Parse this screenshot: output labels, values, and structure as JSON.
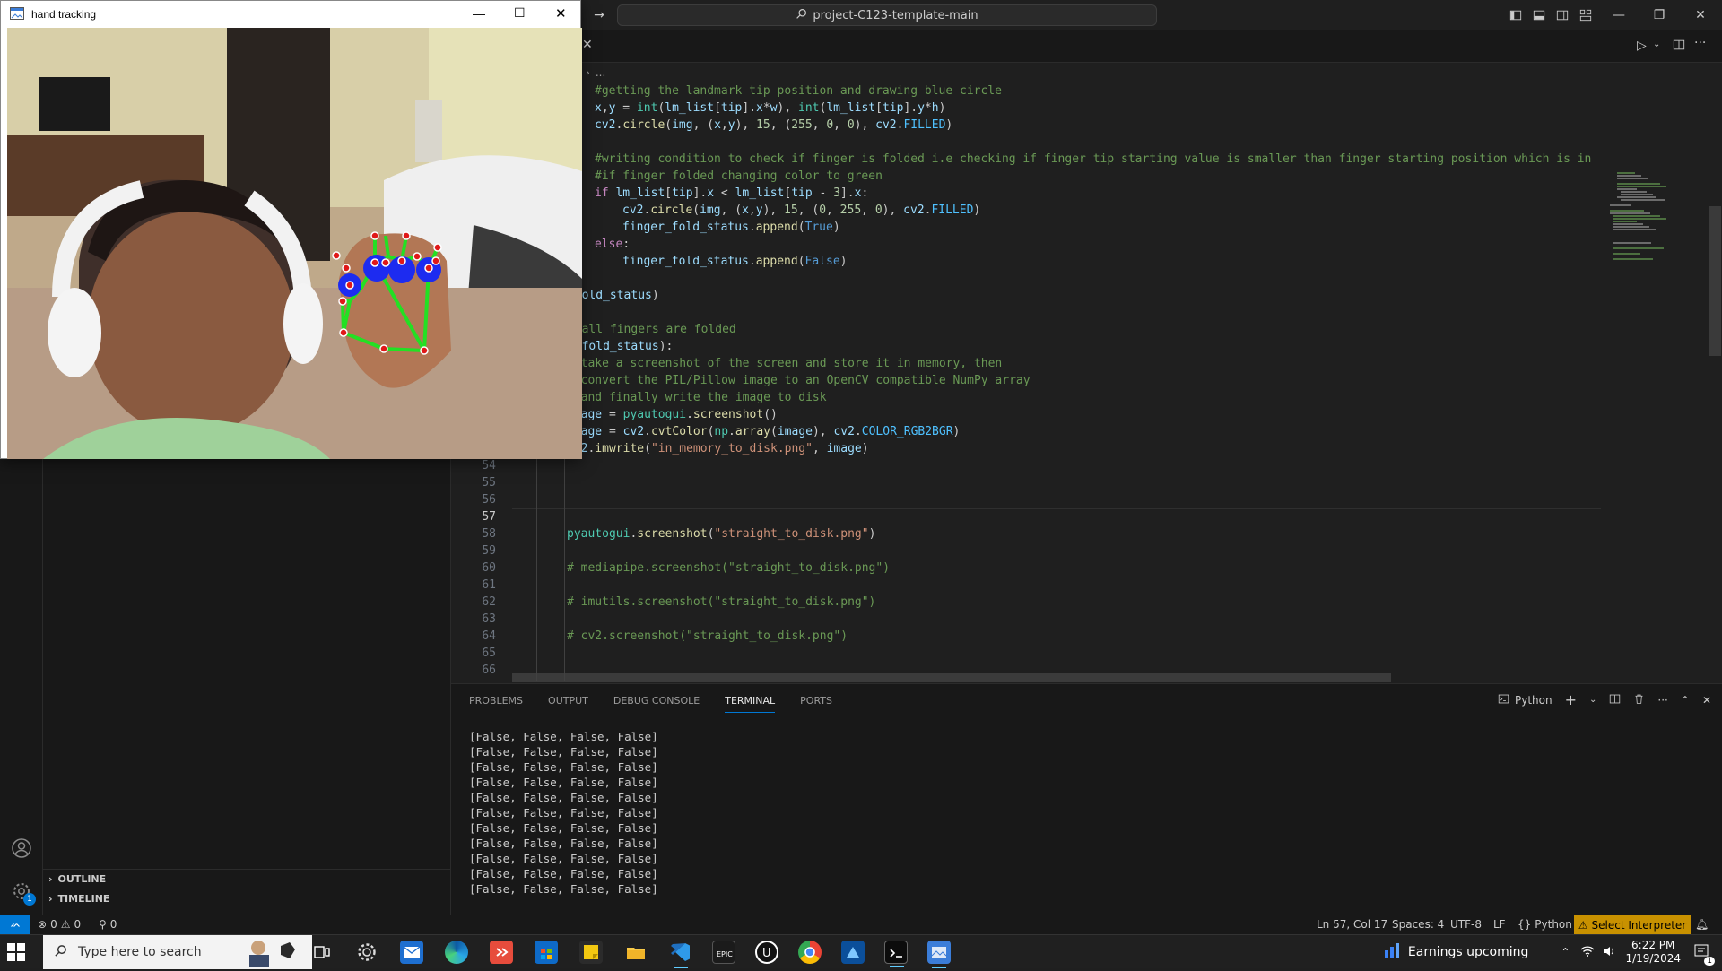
{
  "titlebar": {
    "search_text": "project-C123-template-main",
    "search_icon": "search-icon"
  },
  "hand_window": {
    "title": "hand tracking",
    "minimize_icon": "minimize-icon",
    "maximize_icon": "maximize-icon",
    "close_icon": "close-icon"
  },
  "breadcrumb": "...",
  "editor": {
    "active_line": 57,
    "code_lines": [
      {
        "indent": 2,
        "html": "<span class='tk-com'>#getting the landmark tip position and drawing blue circle</span>"
      },
      {
        "indent": 2,
        "html": "<span class='tk-var'>x</span>,<span class='tk-var'>y</span> = <span class='tk-bi'>int</span>(<span class='tk-var'>lm_list</span>[<span class='tk-var'>tip</span>].<span class='tk-var'>x</span>*<span class='tk-var'>w</span>), <span class='tk-bi'>int</span>(<span class='tk-var'>lm_list</span>[<span class='tk-var'>tip</span>].<span class='tk-var'>y</span>*<span class='tk-var'>h</span>)"
      },
      {
        "indent": 2,
        "html": "<span class='tk-var'>cv2</span>.<span class='tk-fn'>circle</span>(<span class='tk-var'>img</span>, (<span class='tk-var'>x</span>,<span class='tk-var'>y</span>), <span class='tk-num'>15</span>, (<span class='tk-num'>255</span>, <span class='tk-num'>0</span>, <span class='tk-num'>0</span>), <span class='tk-var'>cv2</span>.<span class='tk-cls'>FILLED</span>)"
      },
      {
        "indent": 2,
        "html": ""
      },
      {
        "indent": 2,
        "html": "<span class='tk-com'>#writing condition to check if finger is folded i.e checking if finger tip starting value is smaller than finger starting position which is in</span>"
      },
      {
        "indent": 2,
        "html": "<span class='tk-com'>#if finger folded changing color to green</span>"
      },
      {
        "indent": 2,
        "html": "<span class='tk-kw'>if</span> <span class='tk-var'>lm_list</span>[<span class='tk-var'>tip</span>].<span class='tk-var'>x</span> &lt; <span class='tk-var'>lm_list</span>[<span class='tk-var'>tip</span> - <span class='tk-num'>3</span>].<span class='tk-var'>x</span>:"
      },
      {
        "indent": 3,
        "html": "<span class='tk-var'>cv2</span>.<span class='tk-fn'>circle</span>(<span class='tk-var'>img</span>, (<span class='tk-var'>x</span>,<span class='tk-var'>y</span>), <span class='tk-num'>15</span>, (<span class='tk-num'>0</span>, <span class='tk-num'>255</span>, <span class='tk-num'>0</span>), <span class='tk-var'>cv2</span>.<span class='tk-cls'>FILLED</span>)"
      },
      {
        "indent": 3,
        "html": "<span class='tk-var'>finger_fold_status</span>.<span class='tk-fn'>append</span>(<span class='tk-const'>True</span>)"
      },
      {
        "indent": 2,
        "html": "<span class='tk-kw'>else</span>:"
      },
      {
        "indent": 3,
        "html": "<span class='tk-var'>finger_fold_status</span>.<span class='tk-fn'>append</span>(<span class='tk-const'>False</span>)"
      },
      {
        "indent": 0,
        "html": ""
      },
      {
        "indent": 0,
        "html": "<span class='tk-fn'>print</span>(<span class='tk-var'>finger_fold_status</span>)"
      },
      {
        "indent": 0,
        "html": ""
      },
      {
        "indent": 0,
        "html": " <span class='tk-com'>#checking if all fingers are folded</span>"
      },
      {
        "indent": 0,
        "html": "<span class='tk-kw'>if</span> <span class='tk-fn'>all</span>(<span class='tk-var'>finger_fold_status</span>):"
      },
      {
        "indent": 1,
        "html": "<span class='tk-com'># take a screenshot of the screen and store it in memory, then</span>"
      },
      {
        "indent": 1,
        "html": "<span class='tk-com'># convert the PIL/Pillow image to an OpenCV compatible NumPy array</span>"
      },
      {
        "indent": 1,
        "html": "<span class='tk-com'># and finally write the image to disk</span>"
      },
      {
        "indent": 1,
        "html": "<span class='tk-var'>image</span> = <span class='tk-bi'>pyautogui</span>.<span class='tk-fn'>screenshot</span>()"
      },
      {
        "indent": 1,
        "html": "<span class='tk-var'>image</span> = <span class='tk-var'>cv2</span>.<span class='tk-fn'>cvtColor</span>(<span class='tk-bi'>np</span>.<span class='tk-fn'>array</span>(<span class='tk-var'>image</span>), <span class='tk-var'>cv2</span>.<span class='tk-cls'>COLOR_RGB2BGR</span>)"
      },
      {
        "indent": 1,
        "html": "<span class='tk-var'>cv2</span>.<span class='tk-fn'>imwrite</span>(<span class='tk-str'>\"in_memory_to_disk.png\"</span>, <span class='tk-var'>image</span>)"
      },
      {
        "indent": 1,
        "html": ""
      },
      {
        "indent": 1,
        "html": ""
      },
      {
        "indent": 1,
        "html": ""
      },
      {
        "indent": 1,
        "html": ""
      },
      {
        "indent": 1,
        "html": "<span class='tk-bi'>pyautogui</span>.<span class='tk-fn'>screenshot</span>(<span class='tk-str'>\"straight_to_disk.png\"</span>)"
      },
      {
        "indent": 1,
        "html": ""
      },
      {
        "indent": 1,
        "html": "<span class='tk-com'># mediapipe.screenshot(\"straight_to_disk.png\")</span>"
      },
      {
        "indent": 1,
        "html": ""
      },
      {
        "indent": 1,
        "html": "<span class='tk-com'># imutils.screenshot(\"straight_to_disk.png\")</span>"
      },
      {
        "indent": 1,
        "html": ""
      },
      {
        "indent": 1,
        "html": "<span class='tk-com'># cv2.screenshot(\"straight_to_disk.png\")</span>"
      },
      {
        "indent": 1,
        "html": ""
      },
      {
        "indent": 1,
        "html": ""
      },
      {
        "indent": 1,
        "html": ""
      }
    ],
    "visible_line_numbers": [
      54,
      55,
      56,
      57,
      58,
      59,
      60,
      61,
      62,
      63,
      64,
      65,
      66
    ]
  },
  "sidebar": {
    "outline_label": "OUTLINE",
    "timeline_label": "TIMELINE",
    "settings_badge": "1"
  },
  "panel": {
    "tabs": [
      "PROBLEMS",
      "OUTPUT",
      "DEBUG CONSOLE",
      "TERMINAL",
      "PORTS"
    ],
    "active_tab": "TERMINAL",
    "terminal_name": "Python",
    "terminal_lines": [
      "[False, False, False, False]",
      "[False, False, False, False]",
      "[False, False, False, False]",
      "[False, False, False, False]",
      "[False, False, False, False]",
      "[False, False, False, False]",
      "[False, False, False, False]",
      "[False, False, False, False]",
      "[False, False, False, False]",
      "[False, False, False, False]",
      "[False, False, False, False]"
    ]
  },
  "statusbar": {
    "errors": "0",
    "warnings": "0",
    "ports": "0",
    "position": "Ln 57, Col 17",
    "spaces": "Spaces: 4",
    "encoding": "UTF-8",
    "eol": "LF",
    "language": "Python",
    "interpreter": "Select Interpreter"
  },
  "taskbar": {
    "search_placeholder": "Type here to search",
    "weather_text": "Earnings upcoming",
    "time": "6:22 PM",
    "date": "1/19/2024",
    "notification_count": "1"
  },
  "colors": {
    "accent": "#0078d4",
    "interpreter_warning": "#c89100",
    "editor_bg": "#1f1f1f"
  }
}
